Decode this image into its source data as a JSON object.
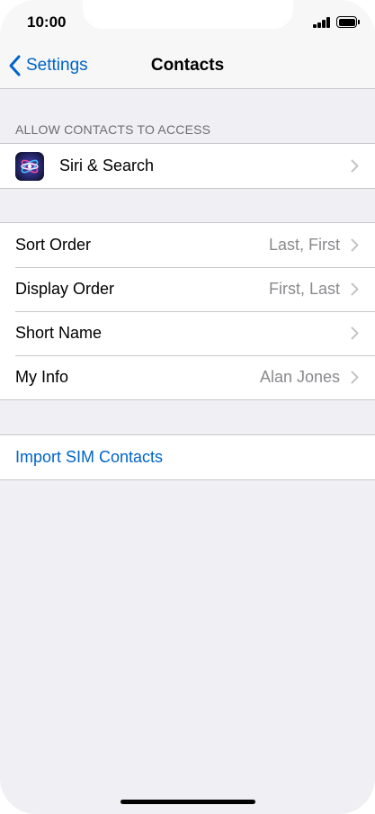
{
  "status_bar": {
    "time": "10:00"
  },
  "nav": {
    "back_label": "Settings",
    "title": "Contacts"
  },
  "access_section": {
    "header": "ALLOW CONTACTS TO ACCESS",
    "items": [
      {
        "label": "Siri & Search",
        "icon": "siri-icon"
      }
    ]
  },
  "options": [
    {
      "label": "Sort Order",
      "value": "Last, First"
    },
    {
      "label": "Display Order",
      "value": "First, Last"
    },
    {
      "label": "Short Name",
      "value": ""
    },
    {
      "label": "My Info",
      "value": "Alan Jones"
    }
  ],
  "import": {
    "label": "Import SIM Contacts"
  },
  "colors": {
    "accent": "#0064c8",
    "background": "#efeff4",
    "separator": "#c8c7cc",
    "secondary_text": "#8a8a8e",
    "section_header": "#6d6d72"
  }
}
